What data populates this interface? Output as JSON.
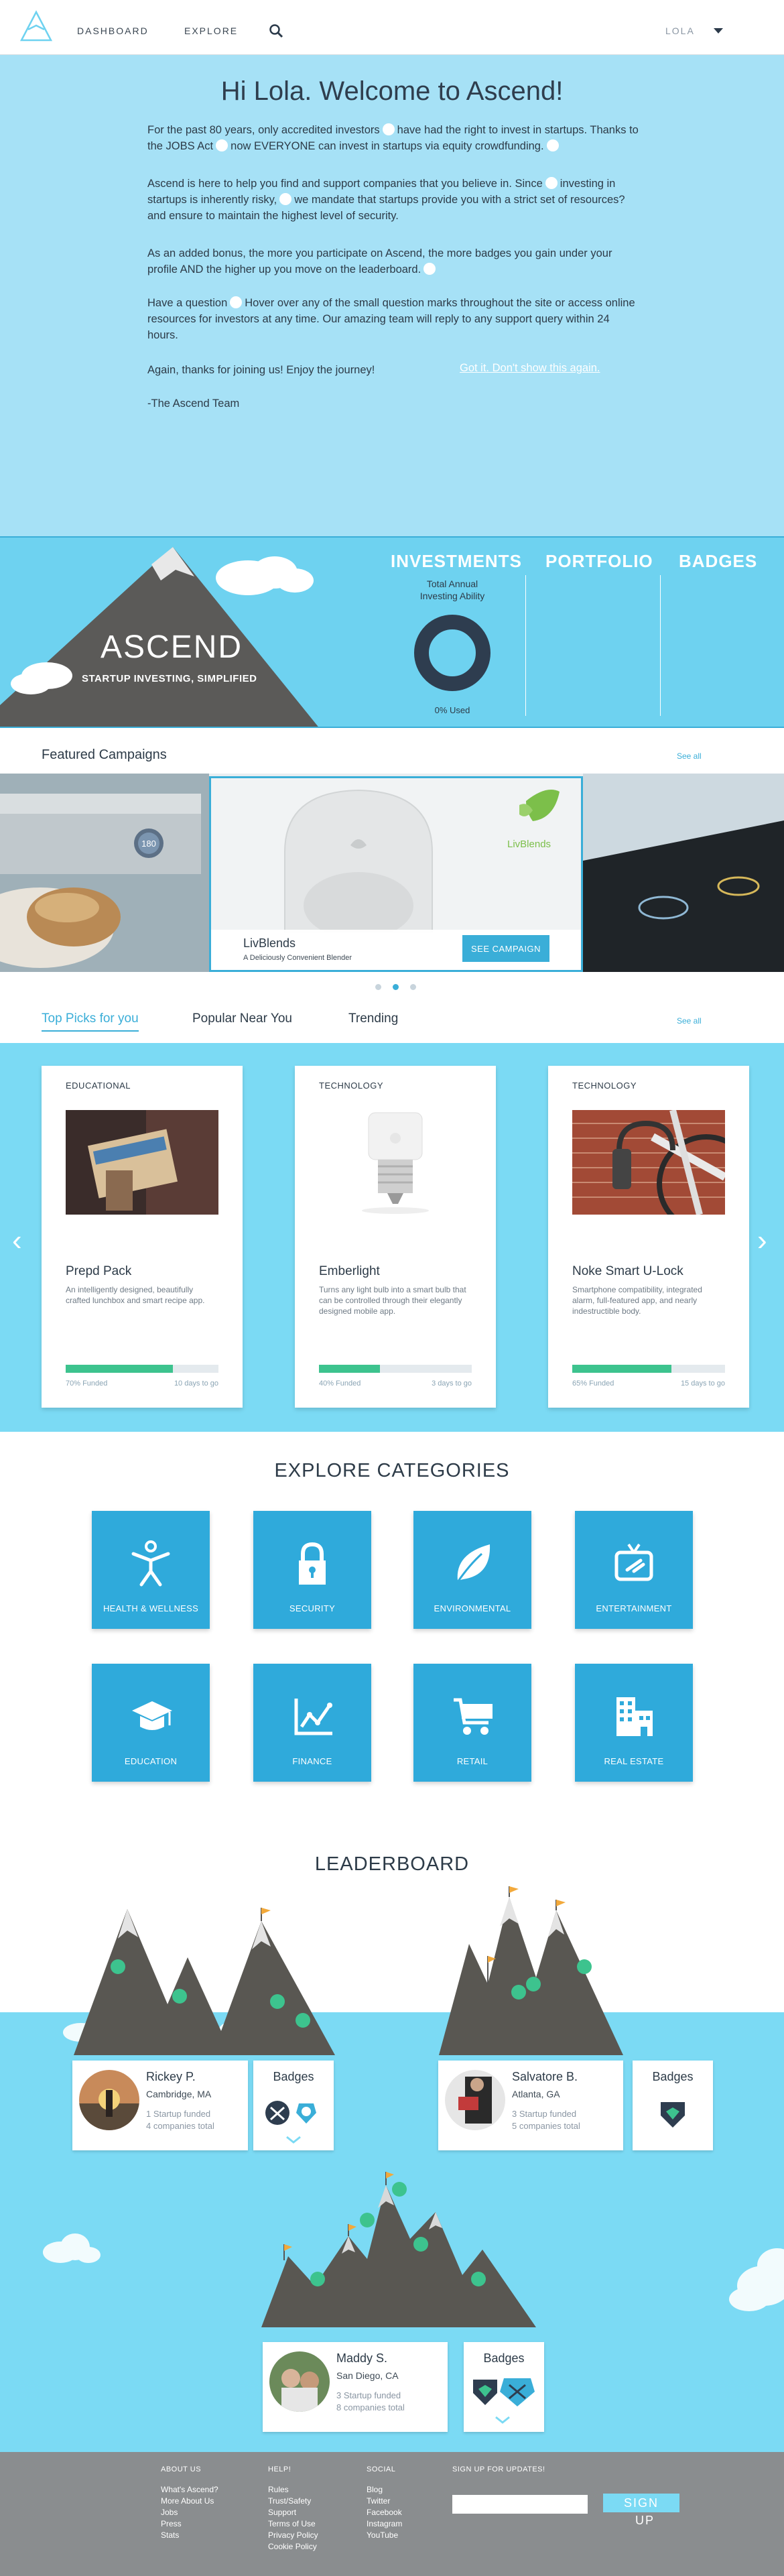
{
  "nav": {
    "dashboard": "DASHBOARD",
    "explore": "EXPLORE",
    "user": "LOLA"
  },
  "welcome": {
    "title": "Hi Lola.  Welcome to Ascend!",
    "p1a": "For the past 80 years, only accredited investors",
    "p1b": "have had the right to invest in startups. Thanks to the JOBS Act",
    "p1c": "now EVERYONE can invest in startups via equity crowdfunding.",
    "p2a": "Ascend is here to help you find and support companies that you believe in.  Since",
    "p2b": "investing in startups is inherently risky,",
    "p2c": "we mandate that startups provide you with a strict set of resources? and ensure to maintain the highest level of security.",
    "p3a": "As an added bonus, the more you participate on Ascend, the more badges you gain under your profile AND the higher up you move on the leaderboard.",
    "p4a": "Have a question",
    "p4b": "Hover over any of the small question marks throughout the site or access online resources for investors at any time. Our amazing team will reply to any support query within 24 hours.",
    "p5": "Again, thanks for joining us!  Enjoy the journey!",
    "dismiss": "Got it. Don't show this again.",
    "sign": "-The Ascend Team"
  },
  "hero": {
    "brand": "ASCEND",
    "tagline": "STARTUP INVESTING, SIMPLIFIED",
    "tabs": [
      "INVESTMENTS",
      "PORTFOLIO",
      "BADGES"
    ],
    "inv_label": "Total Annual Investing Ability",
    "used": "0% Used",
    "used_fraction": 0
  },
  "featured": {
    "heading": "Featured Campaigns",
    "see_all": "See all",
    "campaign_name": "LivBlends",
    "campaign_sub": "A Deliciously Convenient Blender",
    "campaign_btn": "SEE CAMPAIGN",
    "campaign_logo_text": "LivBlends",
    "oven_display": "180",
    "dots_total": 3,
    "dots_active": 1
  },
  "tabs": {
    "top": "Top Picks for you",
    "popular": "Popular Near You",
    "trending": "Trending",
    "see_all": "See all"
  },
  "picks": [
    {
      "category": "EDUCATIONAL",
      "title": "Prepd Pack",
      "desc": "An intelligently designed, beautifully crafted lunchbox and smart recipe app.",
      "funded_pct": 70,
      "funded": "70% Funded",
      "days": "10 days to go"
    },
    {
      "category": "TECHNOLOGY",
      "title": "Emberlight",
      "desc": "Turns any light bulb into a smart bulb that can be controlled through their elegantly designed mobile app.",
      "funded_pct": 40,
      "funded": "40% Funded",
      "days": "3 days to go"
    },
    {
      "category": "TECHNOLOGY",
      "title": "Noke Smart U-Lock",
      "desc": "Smartphone compatibility, integrated alarm, full-featured app, and nearly indestructible body.",
      "funded_pct": 65,
      "funded": "65% Funded",
      "days": "15 days to go"
    }
  ],
  "categories": {
    "title": "EXPLORE CATEGORIES",
    "items": [
      {
        "label": "HEALTH & WELLNESS",
        "icon": "person-icon"
      },
      {
        "label": "SECURITY",
        "icon": "lock-icon"
      },
      {
        "label": "ENVIRONMENTAL",
        "icon": "leaf-icon"
      },
      {
        "label": "ENTERTAINMENT",
        "icon": "tv-icon"
      },
      {
        "label": "EDUCATION",
        "icon": "graduation-cap-icon"
      },
      {
        "label": "FINANCE",
        "icon": "chart-icon"
      },
      {
        "label": "RETAIL",
        "icon": "cart-icon"
      },
      {
        "label": "REAL ESTATE",
        "icon": "building-icon"
      }
    ]
  },
  "leaderboard": {
    "title": "LEADERBOARD",
    "badges_label": "Badges",
    "players": [
      {
        "name": "Rickey P.",
        "location": "Cambridge, MA",
        "stat1": "1 Startup funded",
        "stat2": "4 companies total"
      },
      {
        "name": "Salvatore B.",
        "location": "Atlanta, GA",
        "stat1": "3 Startup funded",
        "stat2": "5 companies total"
      },
      {
        "name": "Maddy S.",
        "location": "San Diego, CA",
        "stat1": "3 Startup funded",
        "stat2": "8 companies total"
      }
    ]
  },
  "footer": {
    "about_h": "ABOUT US",
    "about": [
      "What's Ascend?",
      "More About Us",
      "Jobs",
      "Press",
      "Stats"
    ],
    "help_h": "HELP!",
    "help": [
      "Rules",
      "Trust/Safety",
      "Support",
      "Terms of Use",
      "Privacy Policy",
      "Cookie Policy"
    ],
    "social_h": "SOCIAL",
    "social": [
      "Blog",
      "Twitter",
      "Facebook",
      "Instagram",
      "YouTube"
    ],
    "signup_h": "SIGN UP FOR UPDATES!",
    "signup_btn": "SIGN",
    "signup_btn2": "UP"
  },
  "colors": {
    "accent": "#3aaed8",
    "welcome_bg": "#a6e1f6",
    "picks_bg": "#7bdaf4",
    "progress": "#3dc38e",
    "footer": "#8a8d8f"
  }
}
